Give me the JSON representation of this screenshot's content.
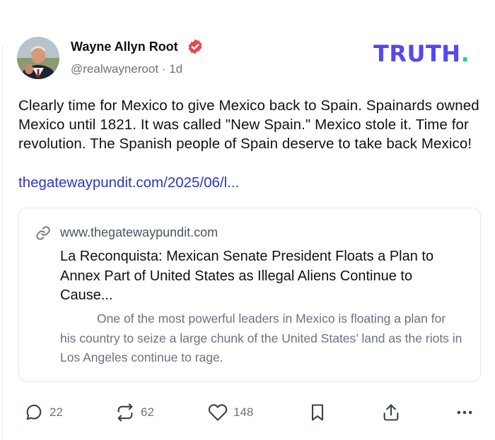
{
  "post": {
    "author_name": "Wayne Allyn Root",
    "handle": "@realwayneroot",
    "separator": "·",
    "time_ago": "1d",
    "body_text": "Clearly time for Mexico to give Mexico back to Spain. Spainards owned Mexico until 1821. It was called \"New Spain.\" Mexico stole it. Time for revolution. The Spanish people of Spain deserve to take back Mexico!",
    "link_text": "thegatewaypundit.com/2025/06/l..."
  },
  "brand": {
    "wordmark": "TRUTH",
    "dot": ".",
    "color": "#5448ee",
    "dot_color": "#1dd1a1"
  },
  "card": {
    "domain": "www.thegatewaypundit.com",
    "title": "La Reconquista: Mexican Senate President Floats a Plan to Annex Part of United States as Illegal Aliens Continue to Cause...",
    "description": "One of the most powerful leaders in Mexico is floating a plan for his country to seize a large chunk of the United States’ land as the riots in Los Angeles continue to rage."
  },
  "actions": {
    "replies": "22",
    "retruths": "62",
    "likes": "148"
  },
  "icons": {
    "verified": "verified-badge-icon",
    "link": "link-icon",
    "reply": "reply-icon",
    "retruth": "retruth-icon",
    "like": "heart-icon",
    "bookmark": "bookmark-icon",
    "share": "share-icon",
    "more": "more-icon"
  }
}
